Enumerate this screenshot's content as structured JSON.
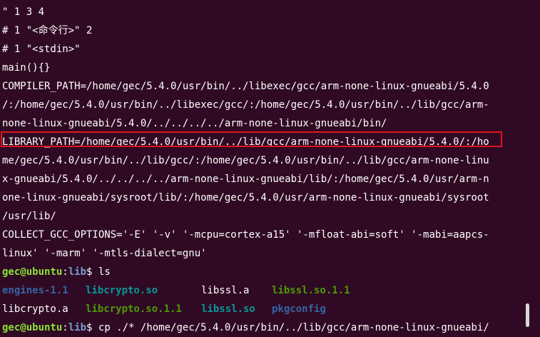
{
  "terminal": {
    "lines": [
      "\" 1 3 4",
      "# 1 \"<命令行>\" 2",
      "# 1 \"<stdin>\"",
      "main(){}",
      "COMPILER_PATH=/home/gec/5.4.0/usr/bin/../libexec/gcc/arm-none-linux-gnueabi/5.4.0",
      "/:/home/gec/5.4.0/usr/bin/../libexec/gcc/:/home/gec/5.4.0/usr/bin/../lib/gcc/arm-",
      "none-linux-gnueabi/5.4.0/../../../../arm-none-linux-gnueabi/bin/",
      "LIBRARY_PATH=/home/gec/5.4.0/usr/bin/../lib/gcc/arm-none-linux-gnueabi/5.4.0/:/ho",
      "me/gec/5.4.0/usr/bin/../lib/gcc/:/home/gec/5.4.0/usr/bin/../lib/gcc/arm-none-linu",
      "x-gnueabi/5.4.0/../../../../arm-none-linux-gnueabi/lib/:/home/gec/5.4.0/usr/arm-n",
      "one-linux-gnueabi/sysroot/lib/:/home/gec/5.4.0/usr/arm-none-linux-gnueabi/sysroot",
      "/usr/lib/",
      "COLLECT_GCC_OPTIONS='-E' '-v' '-mcpu=cortex-a15' '-mfloat-abi=soft' '-mabi=aapcs-",
      "linux' '-marm' '-mtls-dialect=gnu'"
    ],
    "prompt1": {
      "user": "gec@ubuntu",
      "sep": ":",
      "path": "lib",
      "dollar": "$ ",
      "command": "ls"
    },
    "ls_row1": [
      "engines-1.1",
      "libcrypto.so",
      "libssl.a",
      "libssl.so.1.1"
    ],
    "ls_row2": [
      "libcrypto.a",
      "libcrypto.so.1.1",
      "libssl.so",
      "pkgconfig"
    ],
    "prompt2": {
      "user": "gec@ubuntu",
      "sep": ":",
      "path": "lib",
      "dollar": "$ ",
      "command": "cp ./* /home/gec/5.4.0/usr/bin/../lib/gcc/arm-none-linux-gnueabi/"
    },
    "colors": {
      "background": "#300a24",
      "text": "#ffffff",
      "prompt_user": "#8ae234",
      "prompt_path": "#729fcf",
      "directory": "#3465a4",
      "executable": "#4e9a06",
      "symlink": "#06989a",
      "highlight_box": "#e0141e"
    }
  }
}
